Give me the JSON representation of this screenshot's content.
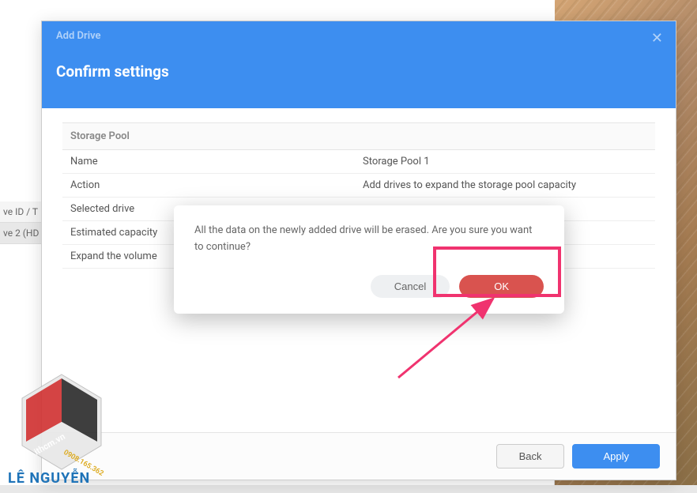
{
  "modal": {
    "breadcrumb": "Add Drive",
    "title": "Confirm settings",
    "close_icon": "✕",
    "section_header": "Storage Pool",
    "rows": [
      {
        "label": "Name",
        "value": "Storage Pool 1"
      },
      {
        "label": "Action",
        "value": "Add drives to expand the storage pool capacity"
      },
      {
        "label": "Selected drive",
        "value": ""
      },
      {
        "label": "Estimated capacity",
        "value": ""
      },
      {
        "label": "Expand the volume",
        "value": ""
      }
    ],
    "footer": {
      "back": "Back",
      "apply": "Apply"
    }
  },
  "confirm": {
    "message": "All the data on the newly added drive will be erased. Are you sure you want to continue?",
    "cancel": "Cancel",
    "ok": "OK"
  },
  "bg_sidebar": {
    "header": "ve ID / T",
    "item": "ve 2 (HD"
  },
  "watermark": {
    "site": "ithcm.vn",
    "phone": "0908.165.362",
    "brand": "LÊ NGUYỄN"
  }
}
